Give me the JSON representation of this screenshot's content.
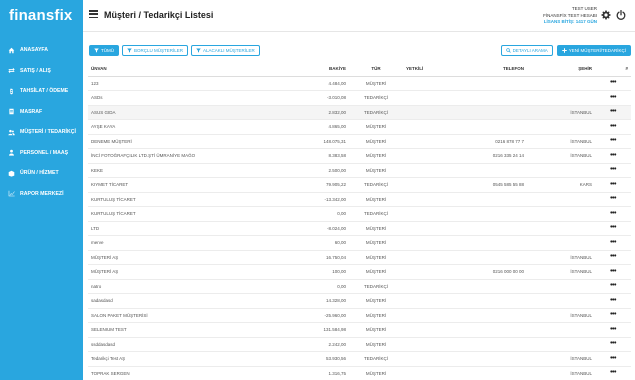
{
  "brand": {
    "logo_text": "finansfix",
    "accent": "#29a6df"
  },
  "sidebar": {
    "items": [
      {
        "label": "ANASAYFA",
        "icon": "home-icon"
      },
      {
        "label": "SATIŞ / ALIŞ",
        "icon": "exchange-icon"
      },
      {
        "label": "TAHSİLAT / ÖDEME",
        "icon": "cash-icon"
      },
      {
        "label": "MASRAF",
        "icon": "receipt-icon"
      },
      {
        "label": "MÜŞTERİ / TEDARİKÇİ",
        "icon": "users-icon"
      },
      {
        "label": "PERSONEL / MAAŞ",
        "icon": "person-icon"
      },
      {
        "label": "ÜRÜN / HİZMET",
        "icon": "box-icon"
      },
      {
        "label": "RAPOR MERKEZİ",
        "icon": "chart-icon"
      }
    ]
  },
  "header": {
    "title": "Müşteri / Tedarikçi Listesi",
    "user_name": "TEST USER",
    "account": "FİNANSFİX TEST HESABI",
    "license": "LİSANS BİTİŞ: 1417 GÜN"
  },
  "filters": {
    "all": "TÜMÜ",
    "debtor": "BORÇLU MÜŞTERİLER",
    "creditor": "ALACAKLI MÜŞTERİLER"
  },
  "actions": {
    "detailed_search": "DETAYLI ARAMA",
    "new": "YENİ MÜŞTERİ/TEDARİKÇİ"
  },
  "table": {
    "columns": {
      "unvan": "ÜNVAN",
      "bakiye": "BAKİYE",
      "tur": "TÜR",
      "yetkili": "YETKİLİ",
      "telefon": "TELEFON",
      "sehir": "ŞEHİR",
      "num": "#"
    },
    "rows": [
      {
        "unvan": "123",
        "bakiye": "4.484,00",
        "tur": "MÜŞTERİ",
        "yetkili": "",
        "telefon": "",
        "sehir": ""
      },
      {
        "unvan": "ASDs",
        "bakiye": "-3.010,08",
        "tur": "TEDARİKÇİ",
        "yetkili": "",
        "telefon": "",
        "sehir": ""
      },
      {
        "unvan": "ASUS GIDA",
        "bakiye": "2.832,00",
        "tur": "TEDARİKÇİ",
        "yetkili": "",
        "telefon": "",
        "sehir": "İSTANBUL"
      },
      {
        "unvan": "AYŞE KAYA",
        "bakiye": "4.865,00",
        "tur": "MÜŞTERİ",
        "yetkili": "",
        "telefon": "",
        "sehir": ""
      },
      {
        "unvan": "DENEME MÜŞTERİ",
        "bakiye": "148.075,31",
        "tur": "MÜŞTERİ",
        "yetkili": "",
        "telefon": "0216 878 77 7",
        "sehir": "İSTANBUL"
      },
      {
        "unvan": "İNCİ FOTOĞRAFÇILIK LTD.ŞTİ ÜMRANİYE MAĞO",
        "bakiye": "8.383,58",
        "tur": "MÜŞTERİ",
        "yetkili": "",
        "telefon": "0216 335 24 14",
        "sehir": "İSTANBUL"
      },
      {
        "unvan": "KEKE",
        "bakiye": "2.500,00",
        "tur": "MÜŞTERİ",
        "yetkili": "",
        "telefon": "",
        "sehir": ""
      },
      {
        "unvan": "KIYMET TİCARET",
        "bakiye": "79.905,22",
        "tur": "TEDARİKÇİ",
        "yetkili": "",
        "telefon": "0545 585 55 88",
        "sehir": "KARS"
      },
      {
        "unvan": "KURTULUŞ TİCARET",
        "bakiye": "-13.342,00",
        "tur": "MÜŞTERİ",
        "yetkili": "",
        "telefon": "",
        "sehir": ""
      },
      {
        "unvan": "KURTULUŞ TİCARET",
        "bakiye": "0,00",
        "tur": "TEDARİKÇİ",
        "yetkili": "",
        "telefon": "",
        "sehir": ""
      },
      {
        "unvan": "LTD",
        "bakiye": "-8.024,00",
        "tur": "MÜŞTERİ",
        "yetkili": "",
        "telefon": "",
        "sehir": ""
      },
      {
        "unvan": "merve",
        "bakiye": "60,00",
        "tur": "MÜŞTERİ",
        "yetkili": "",
        "telefon": "",
        "sehir": ""
      },
      {
        "unvan": "MÜŞTERİ AŞ",
        "bakiye": "16.750,04",
        "tur": "MÜŞTERİ",
        "yetkili": "",
        "telefon": "",
        "sehir": "İSTANBUL"
      },
      {
        "unvan": "MÜŞTERİ AŞ",
        "bakiye": "100,00",
        "tur": "MÜŞTERİ",
        "yetkili": "",
        "telefon": "0216 000 00 00",
        "sehir": "İSTANBUL"
      },
      {
        "unvan": "natro",
        "bakiye": "0,00",
        "tur": "TEDARİKÇİ",
        "yetkili": "",
        "telefon": "",
        "sehir": ""
      },
      {
        "unvan": "sadasdasd",
        "bakiye": "14.328,00",
        "tur": "MÜŞTERİ",
        "yetkili": "",
        "telefon": "",
        "sehir": ""
      },
      {
        "unvan": "SALON PAKET MÜŞTERİSİ",
        "bakiye": "-25.960,00",
        "tur": "MÜŞTERİ",
        "yetkili": "",
        "telefon": "",
        "sehir": "İSTANBUL"
      },
      {
        "unvan": "SELENIUM TEST",
        "bakiye": "131.584,98",
        "tur": "MÜŞTERİ",
        "yetkili": "",
        "telefon": "",
        "sehir": ""
      },
      {
        "unvan": "ssddasdasd",
        "bakiye": "2.242,00",
        "tur": "MÜŞTERİ",
        "yetkili": "",
        "telefon": "",
        "sehir": ""
      },
      {
        "unvan": "Tedarikçi Test AŞ",
        "bakiye": "53.930,56",
        "tur": "TEDARİKÇİ",
        "yetkili": "",
        "telefon": "",
        "sehir": "İSTANBUL"
      },
      {
        "unvan": "TOPRAK SERGEN",
        "bakiye": "1.316,75",
        "tur": "MÜŞTERİ",
        "yetkili": "",
        "telefon": "",
        "sehir": "İSTANBUL"
      }
    ],
    "menu_glyph": "•••"
  }
}
